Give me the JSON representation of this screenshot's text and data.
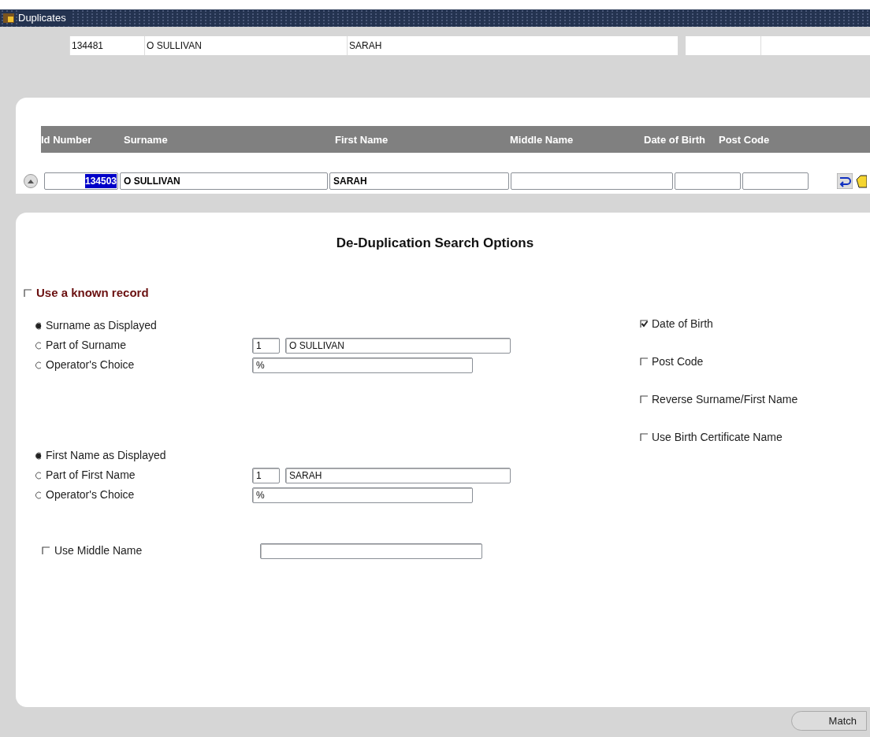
{
  "window": {
    "title": "Duplicates"
  },
  "current_record": [
    "134481",
    "O SULLIVAN",
    "SARAH"
  ],
  "table": {
    "columns": [
      "Id Number",
      "Surname",
      "First Name",
      "Middle Name",
      "Date of Birth",
      "Post Code"
    ],
    "row": {
      "id_number": "134503",
      "id_selected": true,
      "surname": "O SULLIVAN",
      "first_name": "SARAH"
    }
  },
  "options": {
    "title": "De-Duplication Search Options",
    "known_record": {
      "label": "Use a known record",
      "checked": false
    },
    "surname_group": [
      {
        "label": "Surname as Displayed",
        "selected": true
      },
      {
        "label": "Part of Surname",
        "selected": false,
        "count": "1",
        "value": "O SULLIVAN"
      },
      {
        "label": "Operator's Choice",
        "selected": false,
        "value": "%"
      }
    ],
    "first_name_group": [
      {
        "label": "First Name as Displayed",
        "selected": true
      },
      {
        "label": "Part of First Name",
        "selected": false,
        "count": "1",
        "value": "SARAH"
      },
      {
        "label": "Operator's Choice",
        "selected": false,
        "value": "%"
      }
    ],
    "middle_name": {
      "label": "Use Middle Name",
      "checked": false
    },
    "criteria": [
      {
        "label": "Date of Birth",
        "checked": true
      },
      {
        "label": "Post Code",
        "checked": false
      },
      {
        "label": "Reverse Surname/First Name",
        "checked": false
      },
      {
        "label": "Use Birth Certificate Name",
        "checked": false
      }
    ]
  },
  "buttons": [
    "Match"
  ]
}
